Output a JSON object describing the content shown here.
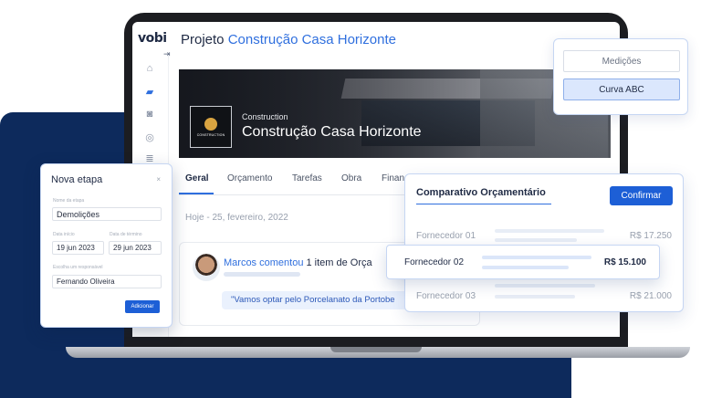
{
  "app": {
    "logo": "vobi"
  },
  "project": {
    "prefix": "Projeto",
    "name": "Construção Casa Horizonte"
  },
  "sidebar": {
    "icons": [
      "home-icon",
      "folder-icon",
      "camera-icon",
      "compass-icon",
      "layers-icon"
    ],
    "active_index": 1
  },
  "banner": {
    "badge_caption": "CONSTRUCTION",
    "subtitle": "Construction",
    "title": "Construção Casa Horizonte"
  },
  "tabs": [
    "Geral",
    "Orçamento",
    "Tarefas",
    "Obra",
    "Finan"
  ],
  "active_tab": "Geral",
  "feed": {
    "date": "Hoje - 25, fevereiro, 2022",
    "comment": {
      "author": "Marcos",
      "verb": "comentou",
      "rest": "1 item de Orça",
      "quote": "\"Vamos optar pelo Porcelanato da Portobe"
    }
  },
  "menu_card": {
    "items": [
      "Medições",
      "Curva ABC"
    ],
    "selected": "Curva ABC"
  },
  "nova_etapa": {
    "title": "Nova etapa",
    "close": "×",
    "name_label": "Nome da etapa",
    "name_value": "Demolições",
    "start_label": "Data início",
    "start_value": "19 jun 2023",
    "end_label": "Data de término",
    "end_value": "29 jun 2023",
    "resp_label": "Escolha um responsável",
    "resp_value": "Fernando Oliveira",
    "add_button": "Adicionar"
  },
  "comparativo": {
    "title": "Comparativo Orçamentário",
    "confirm": "Confirmar",
    "rows": [
      {
        "name": "Fornecedor 01",
        "value": "R$ 17.250"
      },
      {
        "name": "Fornecedor 02",
        "value": "R$ 15.100"
      },
      {
        "name": "Fornecedor 03",
        "value": "R$ 21.000"
      }
    ],
    "highlighted_row": 1
  },
  "colors": {
    "navy": "#0d2a5c",
    "accent": "#2f6fde",
    "button": "#1d5fd6"
  }
}
